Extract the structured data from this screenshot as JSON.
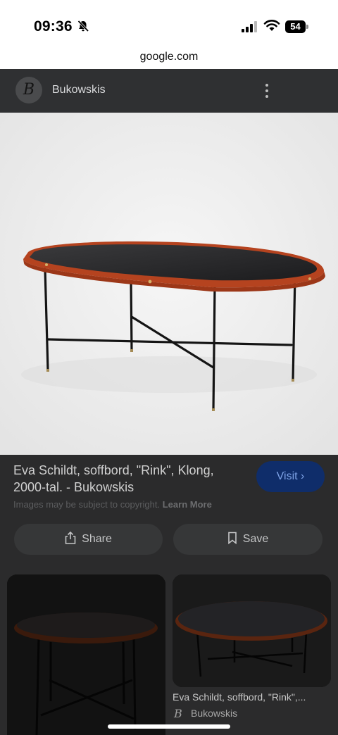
{
  "status_bar": {
    "time": "09:36",
    "battery": "54",
    "icons": [
      "bell-slash-icon",
      "signal-icon",
      "wifi-icon",
      "battery-icon"
    ]
  },
  "browser": {
    "url": "google.com"
  },
  "header": {
    "logo_letter": "B",
    "site_name": "Bukowskis",
    "menu_icon": "more-vert-icon"
  },
  "result": {
    "title": "Eva Schildt, soffbord, \"Rink\", Klong, 2000-tal. - Bukowskis",
    "visit_label": "Visit ›",
    "copyright": "Images may be subject to copyright.",
    "learn_more": "Learn More",
    "share_label": "Share",
    "save_label": "Save"
  },
  "related": [
    {
      "caption": "",
      "source": ""
    },
    {
      "caption": "Eva Schildt, soffbord, \"Rink\",...",
      "source": "Bukowskis",
      "source_logo": "B"
    }
  ],
  "colors": {
    "accent_button": "#0f2d6a",
    "accent_text": "#7da2e6",
    "backdrop": "#2b2b2c"
  }
}
